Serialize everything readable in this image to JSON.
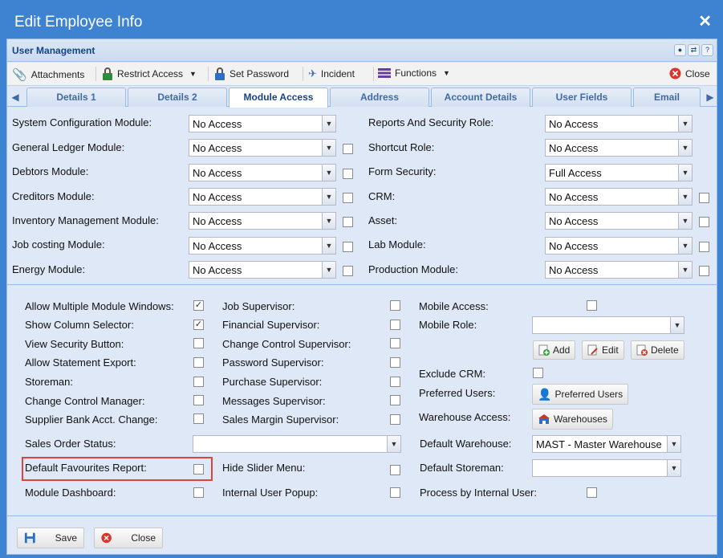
{
  "window": {
    "title": "Edit Employee Info"
  },
  "panel": {
    "title": "User Management"
  },
  "toolbar": {
    "attachments": "Attachments",
    "restrict_access": "Restrict Access",
    "set_password": "Set Password",
    "incident": "Incident",
    "functions": "Functions",
    "close": "Close"
  },
  "tabs": [
    "Details 1",
    "Details 2",
    "Module Access",
    "Address",
    "Account Details",
    "User Fields",
    "Email"
  ],
  "modules_left": [
    {
      "label": "System Configuration Module:",
      "value": "No Access"
    },
    {
      "label": "General Ledger Module:",
      "value": "No Access"
    },
    {
      "label": "Debtors Module:",
      "value": "No Access"
    },
    {
      "label": "Creditors Module:",
      "value": "No Access"
    },
    {
      "label": "Inventory Management Module:",
      "value": "No Access"
    },
    {
      "label": "Job costing Module:",
      "value": "No Access"
    },
    {
      "label": "Energy Module:",
      "value": "No Access"
    }
  ],
  "modules_right": [
    {
      "label": "Reports And Security Role:",
      "value": "No Access"
    },
    {
      "label": "Shortcut Role:",
      "value": "No Access"
    },
    {
      "label": "Form Security:",
      "value": "Full Access"
    },
    {
      "label": "CRM:",
      "value": "No Access"
    },
    {
      "label": "Asset:",
      "value": "No Access"
    },
    {
      "label": "Lab Module:",
      "value": "No Access"
    },
    {
      "label": "Production Module:",
      "value": "No Access"
    }
  ],
  "options_col1": [
    {
      "label": "Allow Multiple Module Windows:",
      "checked": true
    },
    {
      "label": "Show Column Selector:",
      "checked": true
    },
    {
      "label": "View Security Button:",
      "checked": false
    },
    {
      "label": "Allow Statement Export:",
      "checked": false
    },
    {
      "label": "Storeman:",
      "checked": false
    },
    {
      "label": "Change Control Manager:",
      "checked": false
    },
    {
      "label": "Supplier Bank Acct. Change:",
      "checked": false
    }
  ],
  "options_col2": [
    {
      "label": "Job Supervisor:",
      "checked": false
    },
    {
      "label": "Financial Supervisor:",
      "checked": false
    },
    {
      "label": "Change Control Supervisor:",
      "checked": false
    },
    {
      "label": "Password Supervisor:",
      "checked": false
    },
    {
      "label": "Purchase Supervisor:",
      "checked": false
    },
    {
      "label": "Messages Supervisor:",
      "checked": false
    },
    {
      "label": "Sales Margin Supervisor:",
      "checked": false
    }
  ],
  "col3": {
    "mobile_access": "Mobile Access:",
    "mobile_role": "Mobile Role:",
    "add": "Add",
    "edit": "Edit",
    "delete": "Delete",
    "exclude_crm": "Exclude CRM:",
    "preferred_users_label": "Preferred Users:",
    "preferred_users_btn": "Preferred Users",
    "warehouse_access_label": "Warehouse Access:",
    "warehouses_btn": "Warehouses"
  },
  "bottom": {
    "sales_order_status": "Sales Order Status:",
    "default_warehouse_label": "Default Warehouse:",
    "default_warehouse_value": "MAST - Master Warehouse",
    "default_favourites_report": "Default Favourites Report:",
    "hide_slider_menu": "Hide Slider Menu:",
    "default_storeman": "Default Storeman:",
    "module_dashboard": "Module Dashboard:",
    "internal_user_popup": "Internal User Popup:",
    "process_by_internal_user": "Process by Internal User:"
  },
  "footer": {
    "save": "Save",
    "close": "Close"
  },
  "colors": {
    "title_bar": "#3e83d1",
    "panel_bg": "#dfe8f6",
    "header_text": "#15428b",
    "highlight": "#e0423c"
  }
}
